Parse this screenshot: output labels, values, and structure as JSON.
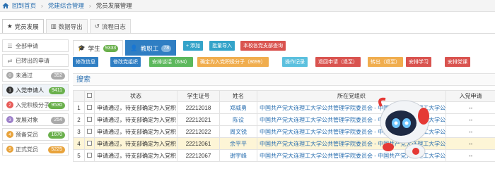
{
  "breadcrumb": {
    "home": "回到首页",
    "level1": "党建综合管理",
    "level2": "党员发展管理"
  },
  "main_tabs": [
    {
      "label": "党员发展",
      "icon": "star-icon",
      "active": true
    },
    {
      "label": "数据导出",
      "icon": "chart-icon",
      "active": false
    },
    {
      "label": "流程日志",
      "icon": "history-icon",
      "active": false
    }
  ],
  "sidebar": [
    {
      "label": "全部申请",
      "count": "",
      "num": "",
      "color": ""
    },
    {
      "label": "已转出的申请",
      "count": "",
      "num": "",
      "color": ""
    },
    {
      "label": "未通过",
      "count": "352",
      "num": "0",
      "color": "#aaaaaa"
    },
    {
      "label": "入党申请人",
      "count": "9411",
      "num": "1",
      "color": "#6ab04c"
    },
    {
      "label": "入党积极分子",
      "count": "9530",
      "num": "2",
      "color": "#e85b58"
    },
    {
      "label": "发展对象",
      "count": "254",
      "num": "3",
      "color": "#9c7fc9"
    },
    {
      "label": "预备党员",
      "count": "1670",
      "num": "4",
      "color": "#e8a33b"
    },
    {
      "label": "正式党员",
      "count": "5225",
      "num": "5",
      "color": "#e8a33b"
    }
  ],
  "sub_tabs": [
    {
      "label": "学生",
      "count": "9333"
    },
    {
      "label": "教职工",
      "count": "78"
    }
  ],
  "top_buttons": [
    {
      "label": "+ 添加",
      "color": "#33a3c9"
    },
    {
      "label": "批量导入",
      "color": "#33a3c9"
    },
    {
      "label": "本校各党支部查询",
      "color": "#d9534f"
    }
  ],
  "action_buttons": [
    {
      "label": "修改信息",
      "color": "#2f7ec3"
    },
    {
      "label": "修改党组织",
      "color": "#2f7ec3"
    },
    {
      "label": "安排谈话（634）",
      "color": "#5cb85c"
    },
    {
      "label": "确定为入党积极分子（8699）",
      "color": "#f0ad4e"
    },
    {
      "label": "操作记录",
      "color": "#5bc0de"
    },
    {
      "label": "退回申请（退至）",
      "color": "#d9534f"
    },
    {
      "label": "转出（退至）",
      "color": "#f0ad4e"
    },
    {
      "label": "安排学习",
      "color": "#d9534f"
    },
    {
      "label": "安排党课",
      "color": "#d9534f"
    }
  ],
  "search_label": "搜索",
  "table": {
    "columns": [
      "",
      "",
      "状态",
      "学生证号",
      "姓名",
      "所在党组织",
      "入党申请"
    ],
    "rows": [
      {
        "idx": "1",
        "status": "申请通过，待支部确定为入党积",
        "id": "22212018",
        "name": "郑威勇",
        "org": "中国共产党大连理工大学公共管理学院委员会 - 中国共产党大连理工大学公共管理学院",
        "date": "--"
      },
      {
        "idx": "2",
        "status": "申请通过，待支部确定为入党积",
        "id": "22212021",
        "name": "陈设",
        "org": "中国共产党大连理工大学公共管理学院委员会 - 中国共产党大连理工大学公共管理学院",
        "date": "--"
      },
      {
        "idx": "3",
        "status": "申请通过，待支部确定为入党积",
        "id": "22212022",
        "name": "周文锐",
        "org": "中国共产党大连理工大学公共管理学院委员会 - 中国共产党大连理工大学公共管理学院",
        "date": "--"
      },
      {
        "idx": "4",
        "status": "申请通过，待支部确定为入党积",
        "id": "22212061",
        "name": "余平平",
        "org": "中国共产党大连理工大学公共管理学院委员会 - 中国共产党大连理工大学公共管理学院",
        "date": "--"
      },
      {
        "idx": "5",
        "status": "申请通过，待支部确定为入党积",
        "id": "22212067",
        "name": "谢宇峰",
        "org": "中国共产党大连理工大学公共管理学院委员会 - 中国共产党大连理工大学公共管理学院",
        "date": "--"
      }
    ]
  }
}
